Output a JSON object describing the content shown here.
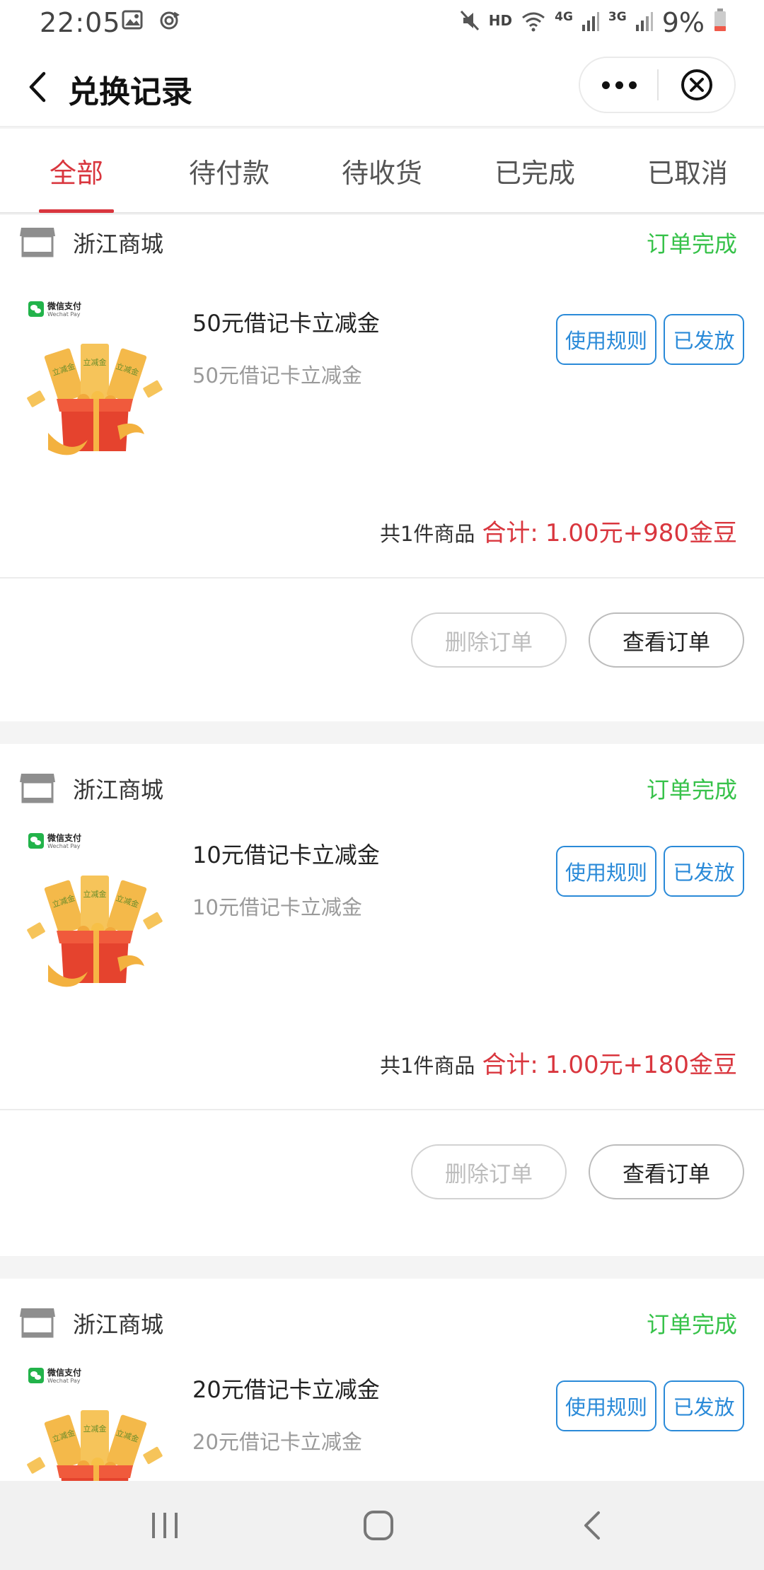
{
  "status_bar": {
    "time": "22:05",
    "hd": "HD",
    "network_a": "4G",
    "network_b": "3G",
    "battery": "9%",
    "icons": [
      "image-icon",
      "sync-icon",
      "mute-icon",
      "wifi-icon",
      "signal-icon",
      "battery-icon"
    ]
  },
  "nav": {
    "title": "兑换记录"
  },
  "tabs": [
    {
      "label": "全部",
      "active": true
    },
    {
      "label": "待付款",
      "active": false
    },
    {
      "label": "待收货",
      "active": false
    },
    {
      "label": "已完成",
      "active": false
    },
    {
      "label": "已取消",
      "active": false
    }
  ],
  "orders": [
    {
      "shop": "浙江商城",
      "status": "订单完成",
      "product_title": "50元借记卡立减金",
      "product_subtitle": "50元借记卡立减金",
      "rule_button": "使用规则",
      "issued_button": "已发放",
      "item_count": "共1件商品",
      "total_label": "合计:",
      "total_amount": "1.00元+980金豆",
      "delete_button": "删除订单",
      "view_button": "查看订单"
    },
    {
      "shop": "浙江商城",
      "status": "订单完成",
      "product_title": "10元借记卡立减金",
      "product_subtitle": "10元借记卡立减金",
      "rule_button": "使用规则",
      "issued_button": "已发放",
      "item_count": "共1件商品",
      "total_label": "合计:",
      "total_amount": "1.00元+180金豆",
      "delete_button": "删除订单",
      "view_button": "查看订单"
    },
    {
      "shop": "浙江商城",
      "status": "订单完成",
      "product_title": "20元借记卡立减金",
      "product_subtitle": "20元借记卡立减金",
      "rule_button": "使用规则",
      "issued_button": "已发放"
    }
  ],
  "product_image": {
    "badge_cn": "微信支付",
    "badge_en": "Wechat Pay",
    "ticket_text": "立减金"
  },
  "colors": {
    "accent_red": "#d9363e",
    "status_green": "#37c24a",
    "button_blue": "#2a8ad8",
    "wechat_green": "#22b34a"
  }
}
